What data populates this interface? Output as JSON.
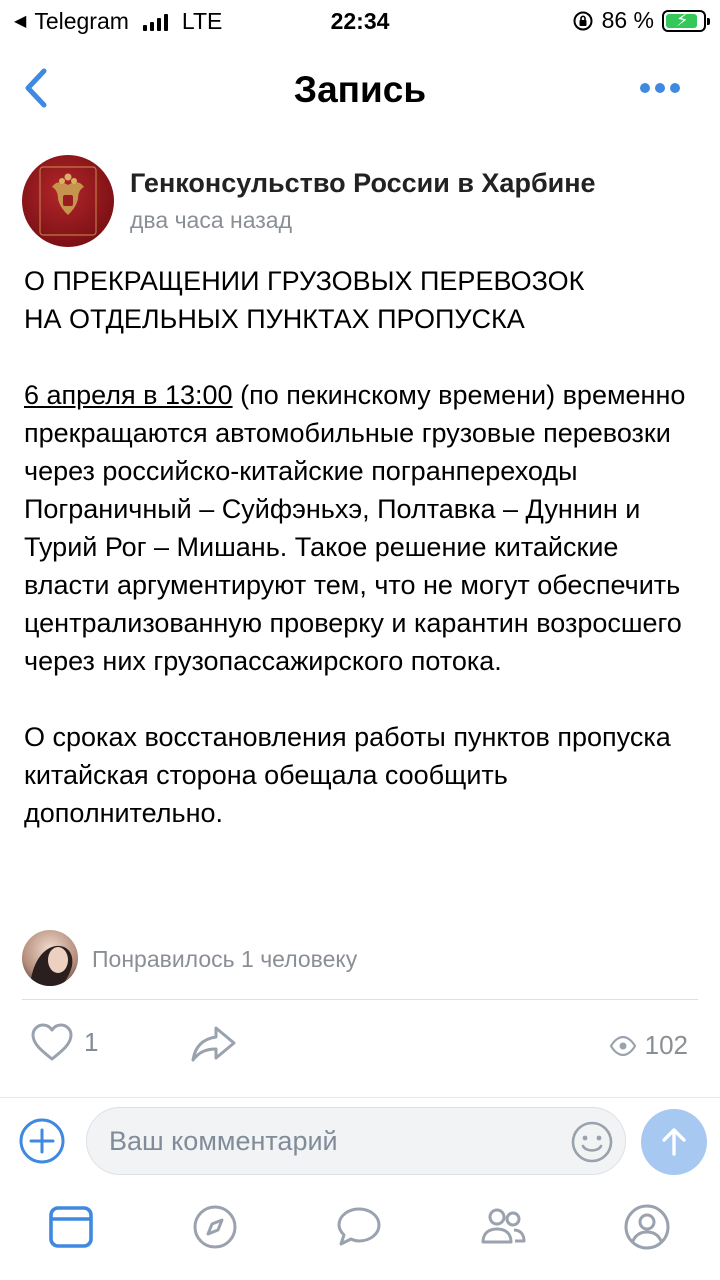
{
  "status_bar": {
    "back_app": "Telegram",
    "network": "LTE",
    "time": "22:34",
    "battery": "86 %",
    "battery_level": 0.86
  },
  "navbar": {
    "title": "Запись"
  },
  "post": {
    "author": "Генконсульство России в Харбине",
    "time": "два часа назад",
    "title_lines": [
      "О ПРЕКРАЩЕНИИ ГРУЗОВЫХ ПЕРЕВОЗОК",
      "НА ОТДЕЛЬНЫХ ПУНКТАХ ПРОПУСКА"
    ],
    "date_link": "6 апреля в 13:00",
    "paragraph1_rest": " (по пекинскому времени) временно прекращаются автомобильные грузовые перевозки через российско-китайские погранпереходы  Пограничный – Суйфэньхэ, Полтавка – Дуннин и Турий Рог – Мишань. Такое решение китайские власти аргументируют тем, что не могут обеспечить централизованную проверку и карантин возросшего через них грузопассажирского потока.",
    "paragraph2": "О сроках восстановления работы пунктов пропуска китайская сторона обещала сообщить дополнительно.",
    "liked_by": "Понравилось 1 человеку",
    "likes": "1",
    "views": "102"
  },
  "comment": {
    "placeholder": "Ваш комментарий"
  },
  "colors": {
    "accent": "#3f8ae0",
    "secondary_text": "#8a8f96",
    "send_button": "#a7c8f0"
  },
  "tabs": [
    {
      "icon": "news-icon"
    },
    {
      "icon": "discover-icon"
    },
    {
      "icon": "messages-icon"
    },
    {
      "icon": "friends-icon"
    },
    {
      "icon": "profile-icon"
    }
  ]
}
